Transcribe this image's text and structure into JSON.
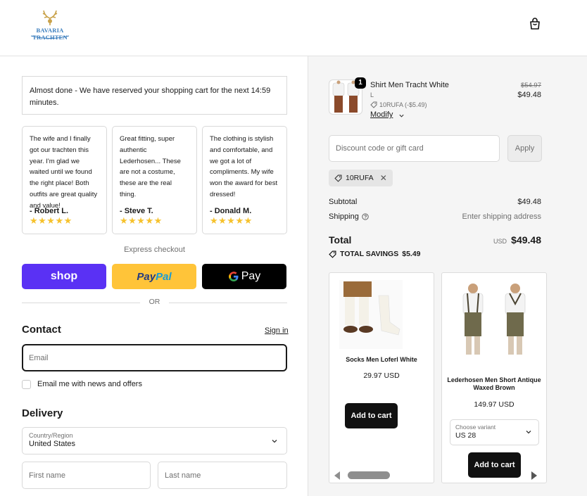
{
  "header": {
    "logo_text": "BAVARIA TRACHTEN",
    "cart_icon": "shopping-bag-icon"
  },
  "reservation": {
    "text": "Almost done - We have reserved your shopping cart for the next 14:59 minutes."
  },
  "reviews": [
    {
      "text": "The wife and I finally got our trachten this year. I'm glad we waited until we found the right place! Both outfits are great quality and value!",
      "author": "- Robert L.",
      "stars": "★★★★★"
    },
    {
      "text": "Great fitting, super authentic Lederhosen... These are not a costume, these are the real thing.",
      "author": "- Steve T.",
      "stars": "★★★★★"
    },
    {
      "text": "The clothing is stylish and comfortable, and we got a lot of compliments. My wife won the award for best dressed!",
      "author": "- Donald M.",
      "stars": "★★★★★"
    }
  ],
  "express": {
    "label": "Express checkout",
    "shop_label": "shop",
    "paypal_part1": "Pay",
    "paypal_part2": "Pal",
    "gpay_label": "Pay",
    "or_label": "OR"
  },
  "contact": {
    "heading": "Contact",
    "signin_label": "Sign in",
    "email_placeholder": "Email",
    "news_label": "Email me with news and offers"
  },
  "delivery": {
    "heading": "Delivery",
    "country_label": "Country/Region",
    "country_value": "United States",
    "first_name_placeholder": "First name",
    "last_name_placeholder": "Last name"
  },
  "order": {
    "item": {
      "quantity": "1",
      "name": "Shirt Men Tracht White",
      "variant": "L",
      "discount_note": "10RUFA (-$5.49)",
      "modify_label": "Modify",
      "old_price": "$54.97",
      "price": "$49.48"
    },
    "discount_placeholder": "Discount code or gift card",
    "apply_label": "Apply",
    "applied_code": "10RUFA",
    "subtotal_label": "Subtotal",
    "subtotal_value": "$49.48",
    "shipping_label": "Shipping",
    "shipping_value": "Enter shipping address",
    "total_label": "Total",
    "total_currency": "USD",
    "total_value": "$49.48",
    "savings_label": "TOTAL SAVINGS",
    "savings_value": "$5.49"
  },
  "recommendations": [
    {
      "name": "Socks Men Loferl White",
      "price": "29.97 USD",
      "button": "Add to cart"
    },
    {
      "name": "Lederhosen Men Short Antique Waxed Brown",
      "price": "149.97 USD",
      "variant_label": "Choose variant",
      "variant_value": "US 28",
      "button": "Add to cart"
    }
  ],
  "colors": {
    "shop_pay": "#5a31f4",
    "paypal": "#ffc439",
    "gpay": "#000000",
    "stars": "#f6c22d",
    "accent_dark": "#111111"
  }
}
